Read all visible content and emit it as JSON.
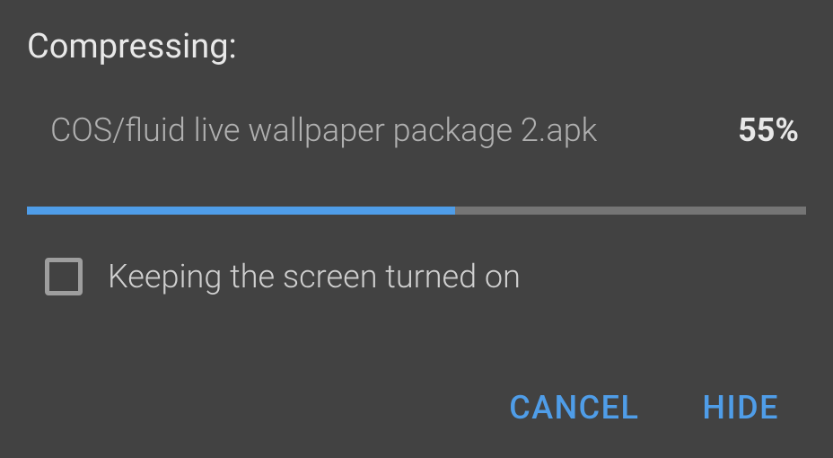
{
  "dialog": {
    "title": "Compressing:",
    "file_name": "COS/fluid live wallpaper package 2.apk",
    "percent_label": "55%",
    "progress_percent": 55,
    "keep_screen_label": "Keeping the screen turned on",
    "keep_screen_checked": false,
    "cancel_label": "CANCEL",
    "hide_label": "HIDE"
  }
}
